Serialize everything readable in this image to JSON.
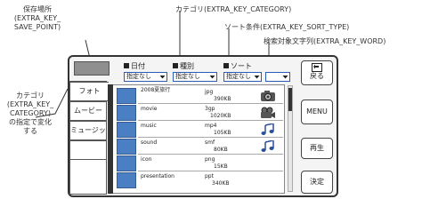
{
  "callouts": {
    "save_point": [
      "保存場所",
      "(EXTRA_KEY_",
      "SAVE_POINT)"
    ],
    "category_top": "カテゴリ(EXTRA_KEY_CATEGORY)",
    "sort_condition": "ソート条件(EXTRA_KEY_SORT_TYPE)",
    "search_word": "検索対象文字列(EXTRA_KEY_WORD)",
    "category_left": [
      "カテゴリ",
      "(EXTRA_KEY_",
      "CATEGORY)",
      "の指定で変化",
      "する"
    ]
  },
  "filters": {
    "date_label": "日付",
    "kind_label": "種別",
    "sort_label": "ソート",
    "select_value": "指定なし"
  },
  "tabs": [
    "フォト",
    "ムービー",
    "ミュージック"
  ],
  "rows": [
    {
      "name": "2008夏旅行",
      "ext": "jpg",
      "size": "390KB",
      "icon": "camera-icon"
    },
    {
      "name": "movie",
      "ext": "3gp",
      "size": "1020KB",
      "icon": "video-camera-icon"
    },
    {
      "name": "music",
      "ext": "mp4",
      "size": "105KB",
      "icon": "music-note-icon"
    },
    {
      "name": "sound",
      "ext": "smf",
      "size": "80KB",
      "icon": "music-note-icon"
    },
    {
      "name": "icon",
      "ext": "png",
      "size": "15KB",
      "icon": ""
    },
    {
      "name": "presentation",
      "ext": "ppt",
      "size": "340KB",
      "icon": ""
    }
  ],
  "buttons": {
    "back": "戻る",
    "menu": "MENU",
    "play": "再生",
    "confirm": "決定"
  }
}
